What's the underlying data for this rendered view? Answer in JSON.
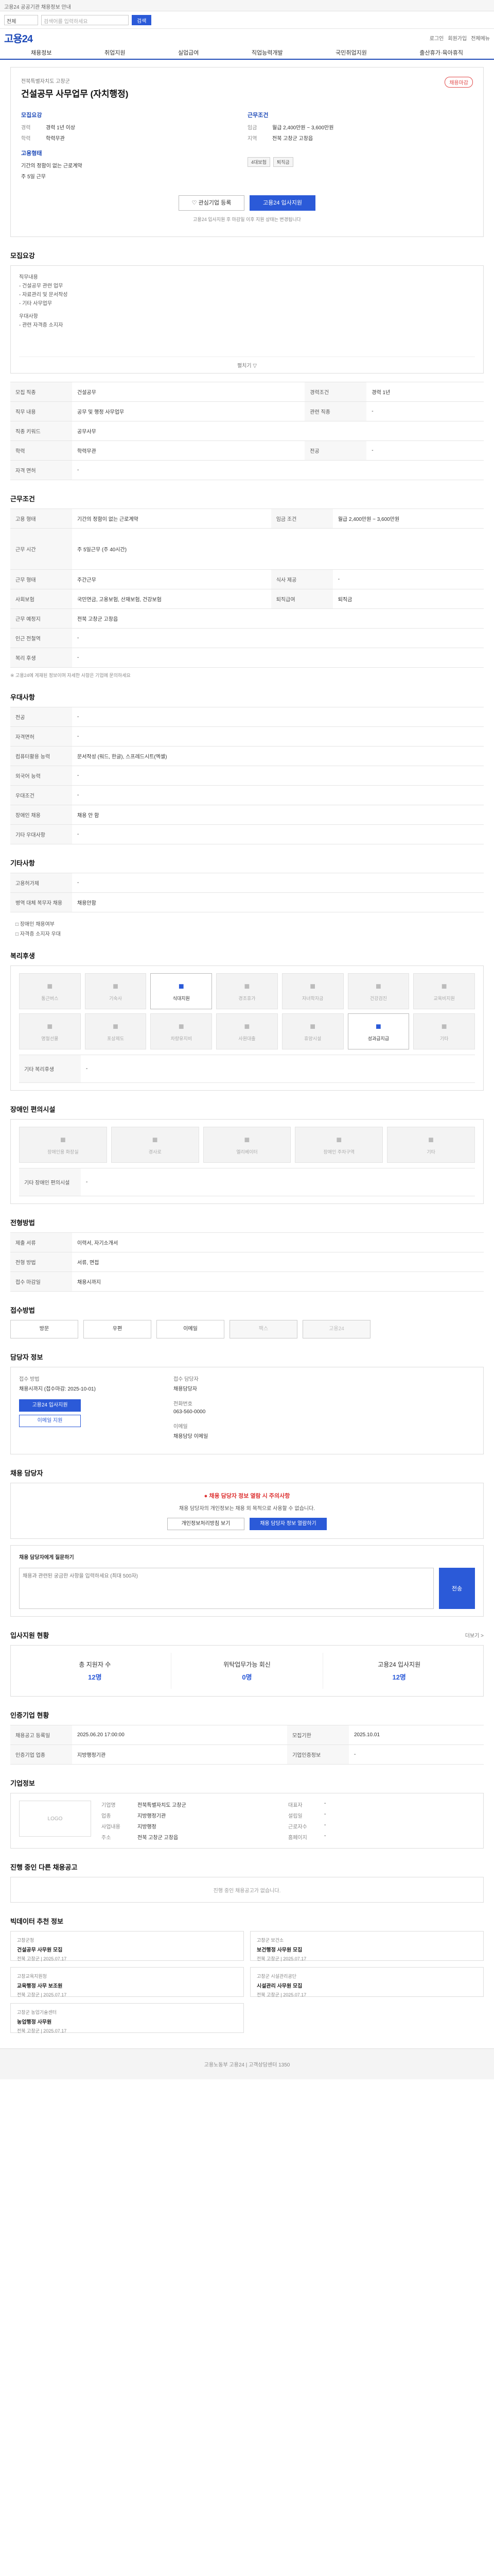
{
  "topbar": {
    "notice": "고용24 공공기관 채용정보 안내"
  },
  "search": {
    "scope": "전체",
    "placeholder": "검색어를 입력하세요",
    "button": "검색"
  },
  "brand": {
    "logo": "고용24",
    "util": [
      "로그인",
      "회원가입",
      "전체메뉴"
    ]
  },
  "nav": [
    "채용정보",
    "취업지원",
    "실업급여",
    "직업능력개발",
    "국민취업지원",
    "출산휴가·육아휴직"
  ],
  "job": {
    "org": "전북특별자치도 고창군",
    "title": "건설공무 사무업무 (자치행정)",
    "badge": "채용마감",
    "recruit_title": "모집요강",
    "recruit": [
      [
        "경력",
        "경력 1년 이상"
      ],
      [
        "학력",
        "학력무관"
      ]
    ],
    "condition_title": "근무조건",
    "condition": [
      [
        "임금",
        "월급 2,400만원 ~ 3,600만원"
      ],
      [
        "지역",
        "전북 고창군 고창읍"
      ]
    ],
    "welfare_title": "고용형태",
    "welfare": [
      "기간의 정함이 없는 근로계약",
      "주 5일 근무"
    ],
    "welfare_chips": [
      "4대보험",
      "퇴직금"
    ],
    "btn_interest": "관심기업 등록",
    "btn_apply": "고용24 입사지원",
    "note": "고용24 입사지원 후 마감일 이후 지원 상태는 변경됩니다"
  },
  "sections": {
    "desc": {
      "title": "모집요강",
      "lines": [
        "직무내용",
        "- 건설공무 관련 업무",
        "- 자료관리 및 문서작성",
        "- 기타 사무업무",
        "우대사항",
        "- 관련 자격증 소지자"
      ],
      "toggle": "펼치기 ▽"
    },
    "req": {
      "rows": [
        [
          "모집 직종",
          "건설공무",
          "경력조건",
          "경력 1년"
        ],
        [
          "직무 내용",
          "공무 및 행정 사무업무",
          "관련 직종",
          "-"
        ],
        [
          "직종 키워드",
          "공무사무",
          "",
          ""
        ],
        [
          "학력",
          "학력무관",
          "전공",
          "-"
        ],
        [
          "자격 면허",
          "-",
          "",
          ""
        ]
      ]
    },
    "work": {
      "title": "근무조건",
      "rows": [
        [
          "고용 형태",
          "기간의 정함이 없는 근로계약",
          "임금 조건",
          "월급 2,400만원 ~ 3,600만원"
        ],
        [
          "근무 시간",
          "주 5일근무 (주 40시간)",
          "",
          ""
        ],
        [
          "근무 형태",
          "주간근무",
          "식사 제공",
          "-"
        ],
        [
          "사회보험",
          "국민연금, 고용보험, 산재보험, 건강보험",
          "퇴직급여",
          "퇴직금"
        ],
        [
          "근무 예정지",
          "전북 고창군 고창읍",
          "",
          ""
        ],
        [
          "인근 전철역",
          "-",
          "",
          ""
        ],
        [
          "복리 후생",
          "-",
          "",
          ""
        ]
      ],
      "note": "※ 고용24에 게재된 정보이며 자세한 사항은 기업에 문의하세요"
    },
    "prefer": {
      "title": "우대사항",
      "rows": [
        [
          "전공",
          "-"
        ],
        [
          "자격면허",
          "-"
        ],
        [
          "컴퓨터활용 능력",
          "문서작성 (워드, 한글), 스프레드시트(엑셀)"
        ],
        [
          "외국어 능력",
          "-"
        ],
        [
          "우대조건",
          "-"
        ],
        [
          "장애인 채용",
          "채용 안 함"
        ],
        [
          "기타 우대사항",
          "-"
        ]
      ]
    },
    "other": {
      "title": "기타사항",
      "rows": [
        [
          "고용허가제",
          "-"
        ],
        [
          "병역 대체 복무자 채용",
          "채용안함"
        ]
      ],
      "bullets": [
        "□ 장애인 채용여부",
        "□ 자격증 소지자 우대"
      ]
    },
    "benefits": {
      "title": "복리후생",
      "tiles": [
        "통근버스",
        "기숙사",
        "식대지원",
        "경조휴가",
        "자녀학자금",
        "건강검진",
        "교육비지원",
        "명절선물",
        "포상제도",
        "차량유지비",
        "사원대출",
        "휴양시설",
        "성과급지급",
        "기타"
      ],
      "on": [
        2,
        12
      ],
      "etc_label": "기타 복리후생"
    },
    "disability": {
      "title": "장애인 편의시설",
      "tiles": [
        "장애인용 화장실",
        "경사로",
        "엘리베이터",
        "장애인 주차구역",
        "기타"
      ],
      "etc_label": "기타 장애인 편의시설"
    },
    "process": {
      "title": "전형방법",
      "rows": [
        [
          "제출 서류",
          "이력서, 자기소개서"
        ],
        [
          "전형 방법",
          "서류, 면접"
        ],
        [
          "접수 마감일",
          "채용시까지"
        ]
      ]
    },
    "method": {
      "title": "접수방법",
      "items": [
        "방문",
        "우편",
        "이메일",
        "팩스",
        "고용24"
      ],
      "off": [
        3,
        4
      ]
    },
    "contact": {
      "title": "담당자 정보",
      "person_label": "접수 방법",
      "person": "채용시까지 (접수마감: 2025-10-01)",
      "btn_apply": "고용24 입사지원",
      "btn_mail": "이메일 지원",
      "manager_label": "접수 담당자",
      "manager": "채용담당자",
      "tel_label": "전화번호",
      "tel": "063-560-0000",
      "email_label": "이메일",
      "email": "채용담당 이메일"
    },
    "warning": {
      "title": "채용 담당자",
      "warn": "채용 담당자 정보 열람 시 주의사항",
      "text": "채용 담당자의 개인정보는 채용 외 목적으로 사용할 수 없습니다.",
      "btns": [
        "개인정보처리방침 보기",
        "채용 담당자 정보 열람하기"
      ]
    },
    "qa": {
      "label": "채용 담당자에게 질문하기",
      "placeholder": "채용과 관련된 궁금한 사항을 입력하세요 (최대 500자)",
      "send": "전송"
    },
    "stats": {
      "title": "입사지원 현황",
      "more": "더보기 >",
      "items": [
        [
          "총 지원자 수",
          "12명"
        ],
        [
          "위탁업무가능 회신",
          "0명"
        ],
        [
          "고용24 입사지원",
          "12명"
        ]
      ]
    },
    "info": {
      "title": "인증기업 현황",
      "rows": [
        [
          "채용공고 등록일",
          "2025.06.20 17:00:00",
          "모집기한",
          "2025.10.01"
        ],
        [
          "인증기업 업종",
          "지방행정기관",
          "기업인증정보",
          "-"
        ]
      ]
    },
    "company": {
      "title": "기업정보",
      "logo": "LOGO",
      "rows": [
        [
          "기업명",
          "전북특별자치도 고창군",
          "대표자",
          "-"
        ],
        [
          "업종",
          "지방행정기관",
          "설립일",
          "-"
        ],
        [
          "사업내용",
          "지방행정",
          "근로자수",
          "-"
        ],
        [
          "주소",
          "전북 고창군 고창읍",
          "홈페이지",
          "-"
        ]
      ]
    },
    "others": {
      "title": "진행 중인 다른 채용공고",
      "empty": "진행 중인 채용공고가 없습니다."
    },
    "recommend": {
      "title": "빅데이터 추천 정보",
      "items": [
        [
          "고창군청",
          "건설공무 사무원 모집",
          "전북 고창군 | 2025.07.17"
        ],
        [
          "고창군 보건소",
          "보건행정 사무원 모집",
          "전북 고창군 | 2025.07.17"
        ],
        [
          "고창교육지원청",
          "교육행정 사무 보조원",
          "전북 고창군 | 2025.07.17"
        ],
        [
          "고창군 시설관리공단",
          "시설관리 사무원 모집",
          "전북 고창군 | 2025.07.17"
        ],
        [
          "고창군 농업기술센터",
          "농업행정 사무원",
          "전북 고창군 | 2025.07.17"
        ]
      ]
    }
  },
  "footer": "고용노동부 고용24 | 고객상담센터 1350"
}
